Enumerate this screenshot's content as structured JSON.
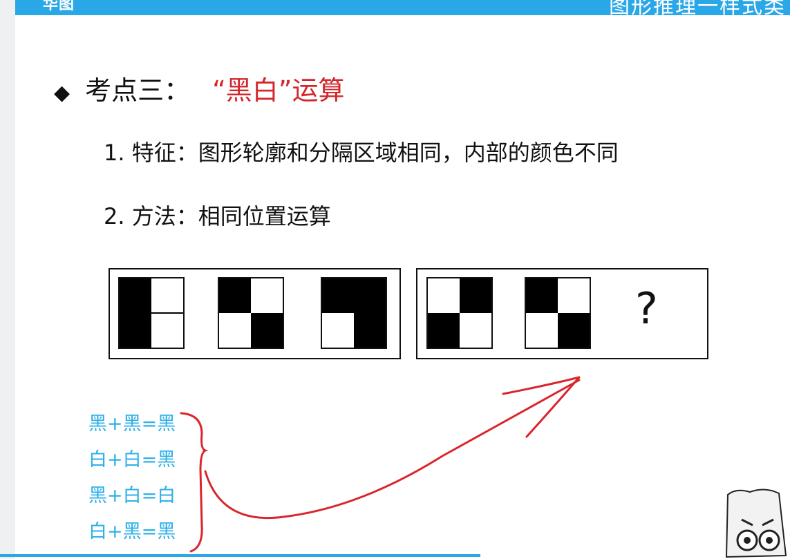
{
  "header": {
    "logo_text": "华图",
    "banner_title": "图形推理一样式类"
  },
  "section": {
    "bullet": "◆",
    "title_prefix": "考点三：",
    "title_highlight": "“黑白”运算"
  },
  "points": [
    {
      "text": "1. 特征：图形轮廓和分隔区域相同，内部的颜色不同"
    },
    {
      "text": "2. 方法：相同位置运算"
    }
  ],
  "puzzle": {
    "question_mark": "?",
    "fill_color": "#000000",
    "empty_color": "#ffffff"
  },
  "rules": [
    {
      "text": "黑+黑=黑"
    },
    {
      "text": "白+白=黑"
    },
    {
      "text": "黑+白=白"
    },
    {
      "text": "白+黑=黑"
    }
  ],
  "colors": {
    "accent": "#2aa7e6",
    "title_red": "#d3272c",
    "rule_blue": "#2cb0e8",
    "annotation_red": "#d9262c"
  }
}
